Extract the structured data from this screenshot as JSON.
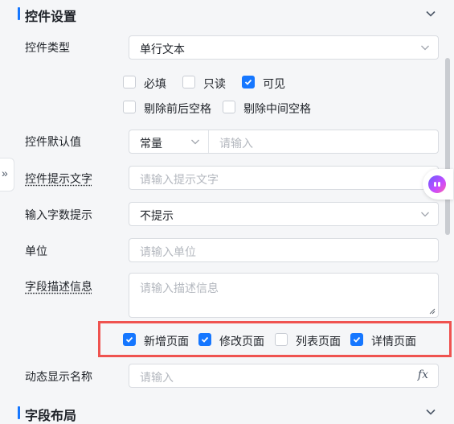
{
  "section1": {
    "title": "控件设置"
  },
  "section2": {
    "title": "字段布局"
  },
  "fields": {
    "type": {
      "label": "控件类型",
      "value": "单行文本"
    },
    "default": {
      "label": "控件默认值",
      "mode": "常量",
      "placeholder": "请输入"
    },
    "hint": {
      "label": "控件提示文字",
      "placeholder": "请输入提示文字"
    },
    "countHint": {
      "label": "输入字数提示",
      "value": "不提示"
    },
    "unit": {
      "label": "单位",
      "placeholder": "请输入单位"
    },
    "desc": {
      "label": "字段描述信息",
      "placeholder": "请输入描述信息"
    },
    "dynamic": {
      "label": "动态显示名称",
      "placeholder": "请输入",
      "fx": "fx"
    }
  },
  "checks": [
    {
      "label": "必填",
      "checked": false
    },
    {
      "label": "只读",
      "checked": false
    },
    {
      "label": "可见",
      "checked": true
    },
    {
      "label": "剔除前后空格",
      "checked": false
    },
    {
      "label": "剔除中间空格",
      "checked": false
    }
  ],
  "pages": [
    {
      "label": "新增页面",
      "checked": true
    },
    {
      "label": "修改页面",
      "checked": true
    },
    {
      "label": "列表页面",
      "checked": false
    },
    {
      "label": "详情页面",
      "checked": true
    }
  ],
  "expand": {
    "glyph": "»"
  },
  "colors": {
    "accent": "#1677ff",
    "highlight": "#ef5350"
  }
}
